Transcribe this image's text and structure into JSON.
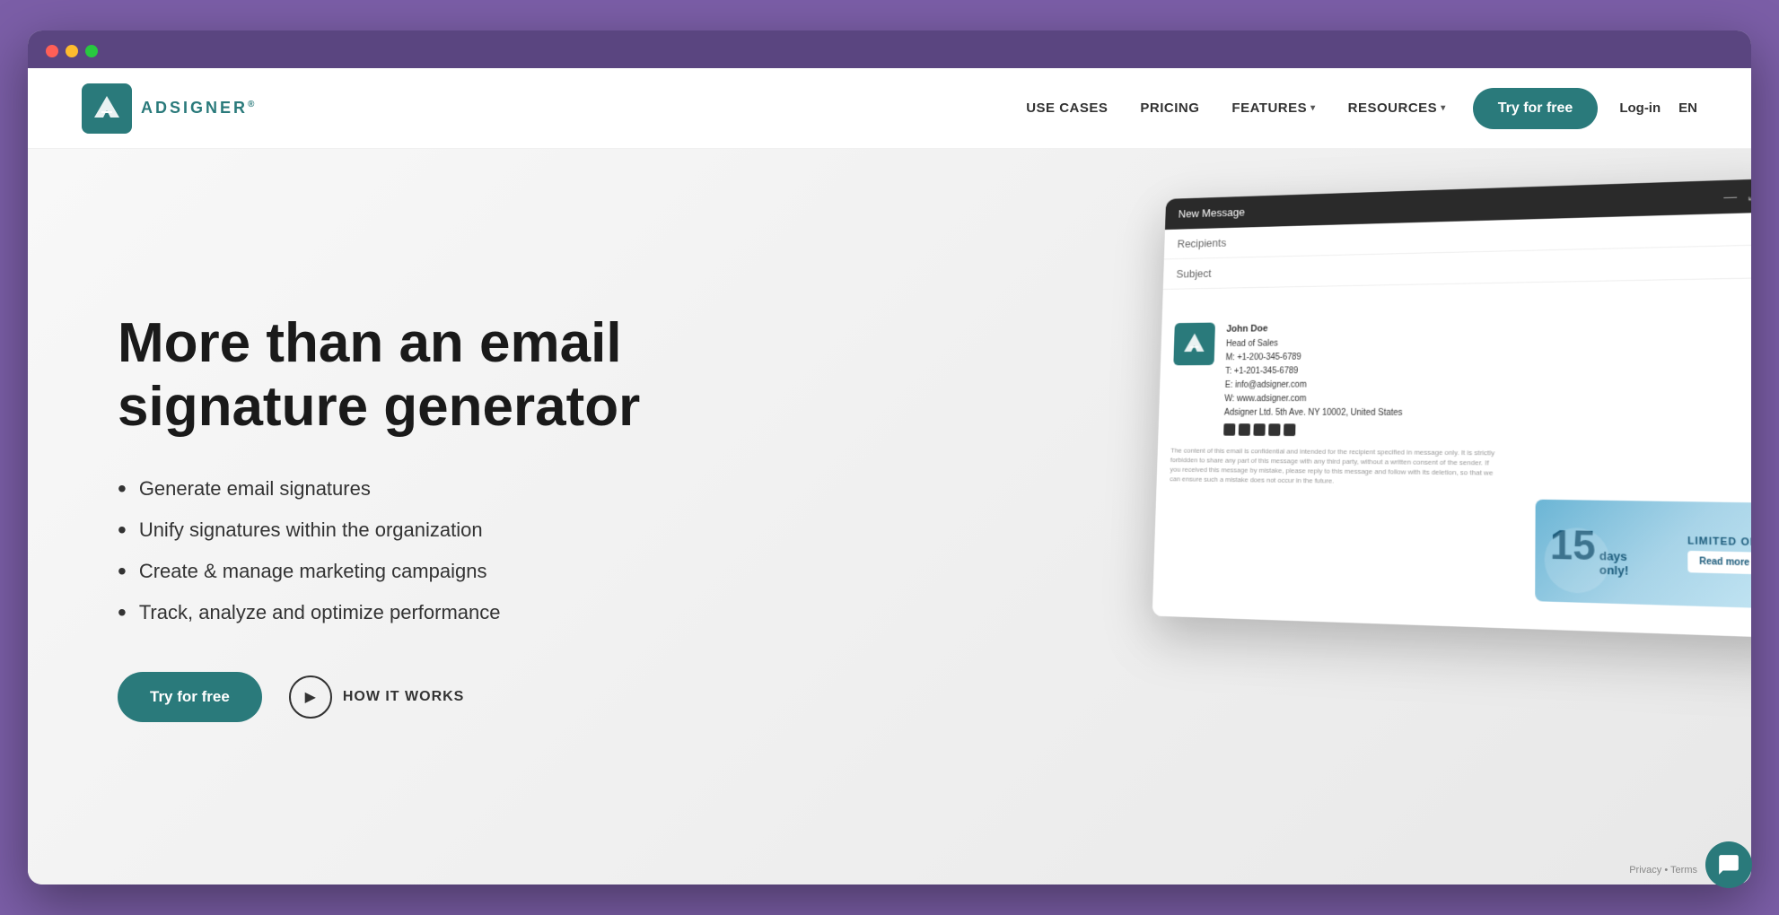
{
  "browser": {
    "bg_color": "#7b5ea7"
  },
  "logo": {
    "text": "ADSIGNER",
    "reg_symbol": "®"
  },
  "nav": {
    "use_cases": "USE CASES",
    "pricing": "PRICING",
    "features": "FEATURES",
    "resources": "RESOURCES",
    "try_for_free": "Try for free",
    "login": "Log-in",
    "lang": "EN"
  },
  "hero": {
    "title": "More than an email signature generator",
    "bullets": [
      "Generate email signatures",
      "Unify signatures within the organization",
      "Create & manage marketing campaigns",
      "Track, analyze and optimize performance"
    ],
    "cta_primary": "Try for free",
    "cta_secondary": "HOW IT WORKS"
  },
  "email_mockup": {
    "titlebar": "New Message",
    "recipients_label": "Recipients",
    "subject_label": "Subject",
    "sig_name": "John Doe",
    "sig_title": "Head of Sales",
    "sig_mobile": "M: +1-200-345-6789",
    "sig_tel": "T: +1-201-345-6789",
    "sig_email": "E: info@adsigner.com",
    "sig_web": "W: www.adsigner.com",
    "sig_company": "Adsigner Ltd. 5th Ave. NY 10002, United States",
    "disclaimer": "The content of this email is confidential and intended for the recipient specified in message only. It is strictly forbidden to share any part of this message with any third party, without a written consent of the sender. If you received this message by mistake, please reply to this message and follow with its deletion, so that we can ensure such a mistake does not occur in the future."
  },
  "promo": {
    "days": "15",
    "days_label": "days",
    "only": "only!",
    "offer": "LIMITED OFFER!",
    "read_more": "Read more"
  },
  "privacy": {
    "text": "Privacy • Terms"
  }
}
